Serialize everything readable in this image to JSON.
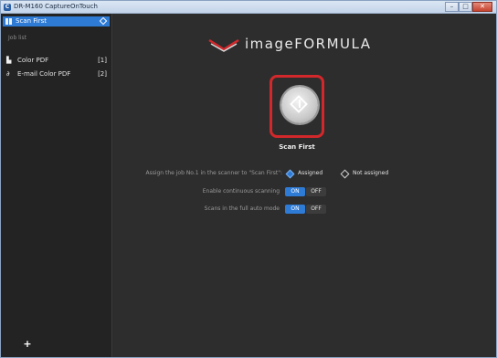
{
  "window": {
    "title": "DR-M160 CaptureOnTouch",
    "app_icon": "C",
    "buttons": {
      "minimize": "–",
      "maximize": "□",
      "close": "✕"
    }
  },
  "sidebar": {
    "scan_first": {
      "label": "Scan First",
      "icon": "grid-icon"
    },
    "job_list_label": "Job list",
    "jobs": [
      {
        "name": "Color PDF",
        "number": "[1]",
        "icon": "document-icon"
      },
      {
        "name": "E-mail Color PDF",
        "number": "[2]",
        "icon": "paperclip-icon"
      }
    ],
    "add_button": "+"
  },
  "main": {
    "logo_text": "imageFORMULA",
    "scan_caption": "Scan First",
    "assign": {
      "label": "Assign the job No.1 in the scanner to \"Scan First\":",
      "options": [
        {
          "label": "Assigned",
          "selected": true
        },
        {
          "label": "Not assigned",
          "selected": false
        }
      ]
    },
    "continuous": {
      "label": "Enable continuous scanning",
      "on": "ON",
      "off": "OFF",
      "value": "ON"
    },
    "full_auto": {
      "label": "Scans in the full auto mode",
      "on": "ON",
      "off": "OFF",
      "value": "ON"
    }
  },
  "colors": {
    "accent": "#2e7bd6",
    "highlight_frame": "#d2282b",
    "background": "#2d2d2d"
  }
}
